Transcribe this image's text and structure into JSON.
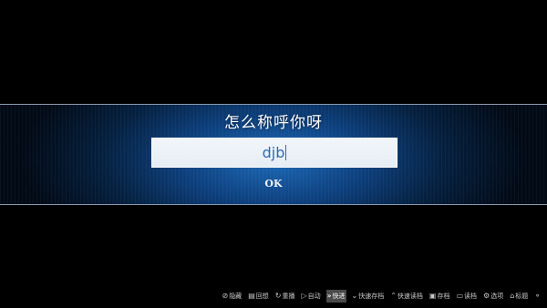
{
  "dialog": {
    "prompt": "怎么称呼你呀",
    "input_value": "djb",
    "ok_label": "OK"
  },
  "quick_menu": {
    "items": [
      {
        "icon": "eye-slash-icon",
        "glyph": "⊘",
        "label": "隐藏"
      },
      {
        "icon": "history-icon",
        "glyph": "▤",
        "label": "回想"
      },
      {
        "icon": "replay-icon",
        "glyph": "↻",
        "label": "重播"
      },
      {
        "icon": "play-icon",
        "glyph": "▷",
        "label": "自动"
      },
      {
        "icon": "fast-forward-icon",
        "glyph": "»",
        "label": "快进"
      },
      {
        "icon": "quick-save-icon",
        "glyph": "⌄",
        "label": "快速存档"
      },
      {
        "icon": "quick-load-icon",
        "glyph": "⌃",
        "label": "快速读档"
      },
      {
        "icon": "save-icon",
        "glyph": "▣",
        "label": "存档"
      },
      {
        "icon": "load-folder-icon",
        "glyph": "▭",
        "label": "读档"
      },
      {
        "icon": "options-gear-icon",
        "glyph": "⚙",
        "label": "选项"
      },
      {
        "icon": "title-home-icon",
        "glyph": "⌂",
        "label": "标题"
      },
      {
        "icon": "lock-icon",
        "glyph": "🔒",
        "label": ""
      }
    ],
    "active_label": "快进"
  }
}
